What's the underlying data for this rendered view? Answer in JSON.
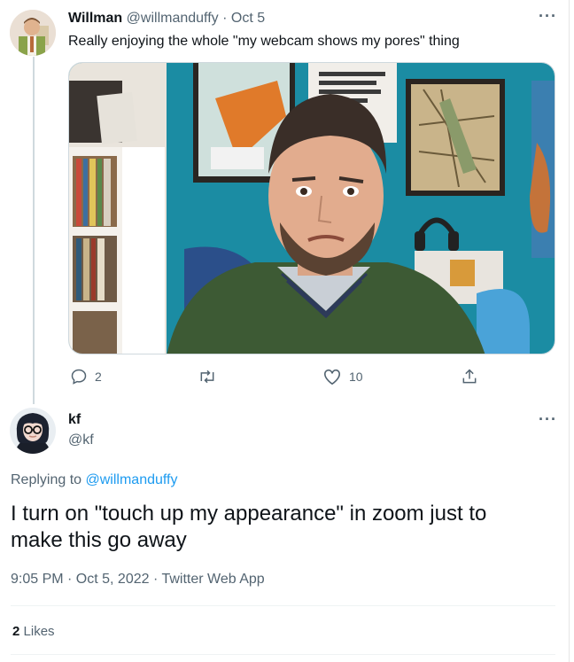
{
  "original_tweet": {
    "author_name": "Willman",
    "author_handle": "@willmanduffy",
    "separator": "·",
    "date": "Oct 5",
    "text": "Really enjoying the whole \"my webcam shows my pores\" thing",
    "more_icon": "more-horizontal-icon",
    "media_icon": "webcam-photo",
    "actions": {
      "reply_count": "2",
      "retweet_count": "",
      "like_count": "10",
      "share_count": ""
    }
  },
  "reply_tweet": {
    "author_name": "kf",
    "author_handle": "@kf",
    "replying_prefix": "Replying to",
    "replying_handle": "@willmanduffy",
    "text": "I turn on \"touch up my appearance\" in zoom just to make this go away",
    "timestamp": "9:05 PM · Oct 5, 2022 · Twitter Web App",
    "likes_count": "2",
    "likes_label": "Likes"
  },
  "colors": {
    "link": "#1d9bf0",
    "text_primary": "#0f1419",
    "text_secondary": "#536471",
    "wall_teal": "#1b8ca3"
  }
}
